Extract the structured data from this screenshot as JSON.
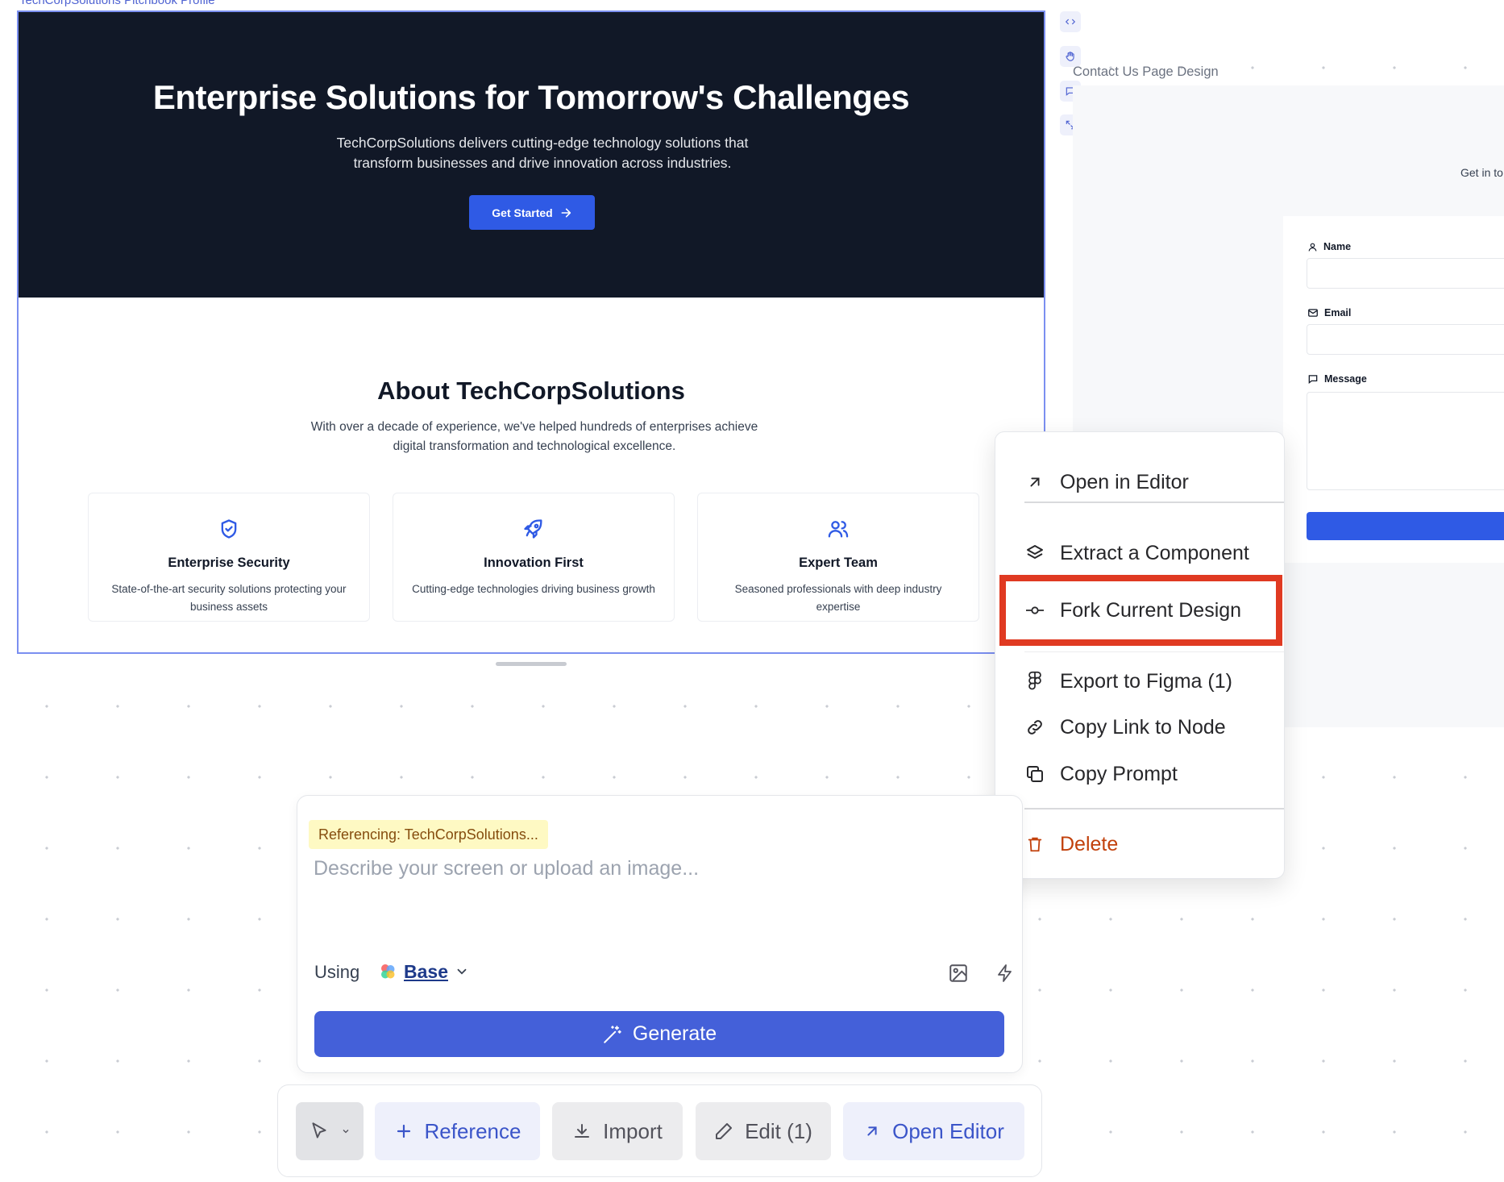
{
  "canvas": {
    "frame_label": "TechCorpSolutions Pitchbook Profile",
    "side_tools": [
      "code-icon",
      "hand-icon",
      "comment-icon",
      "expand-icon"
    ]
  },
  "design": {
    "hero": {
      "title": "Enterprise Solutions for Tomorrow's Challenges",
      "description": "TechCorpSolutions delivers cutting-edge technology solutions that transform businesses and drive innovation across industries.",
      "cta_label": "Get Started"
    },
    "about": {
      "title": "About TechCorpSolutions",
      "description": "With over a decade of experience, we've helped hundreds of enterprises achieve digital transformation and technological excellence.",
      "cards": [
        {
          "icon": "shield-check-icon",
          "title": "Enterprise Security",
          "text": "State-of-the-art security solutions protecting your business assets"
        },
        {
          "icon": "rocket-icon",
          "title": "Innovation First",
          "text": "Cutting-edge technologies driving business growth"
        },
        {
          "icon": "users-icon",
          "title": "Expert Team",
          "text": "Seasoned professionals with deep industry expertise"
        }
      ]
    }
  },
  "contact_design": {
    "label": "Contact Us Page Design",
    "get_in_touch": "Get in to",
    "fields": {
      "name": "Name",
      "email": "Email",
      "message": "Message"
    }
  },
  "context_menu": {
    "items": {
      "open_editor": "Open in Editor",
      "extract": "Extract a Component",
      "fork": "Fork Current Design",
      "export_figma": "Export to Figma (1)",
      "copy_link": "Copy Link to Node",
      "copy_prompt": "Copy Prompt",
      "delete": "Delete"
    },
    "highlighted_item": "Fork Current Design",
    "colors": {
      "highlight": "#e03a22",
      "delete": "#c2410c"
    }
  },
  "prompt_panel": {
    "referencing": "Referencing: TechCorpSolutions...",
    "placeholder": "Describe your screen or upload an image...",
    "using_label": "Using",
    "model": "Base",
    "generate_label": "Generate"
  },
  "toolbar": {
    "reference": "Reference",
    "import": "Import",
    "edit": "Edit (1)",
    "open_editor": "Open Editor"
  },
  "colors": {
    "accent": "#4460d9",
    "hero_bg": "#111827",
    "hero_button": "#2f5ae5"
  }
}
